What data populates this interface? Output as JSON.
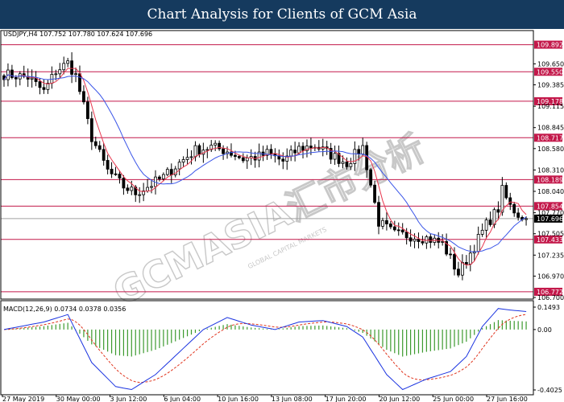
{
  "header": {
    "title": "Chart Analysis for Clients of GCM Asia"
  },
  "chart_data": {
    "type": "candlestick",
    "symbol_info": "USDJPY,H4  107.752 107.780 107.624 107.696",
    "price_axis": {
      "range": [
        106.7,
        110.05
      ],
      "ticks": [
        "109.650",
        "109.385",
        "109.115",
        "108.845",
        "108.580",
        "108.310",
        "108.040",
        "107.770",
        "107.505",
        "107.235",
        "106.970",
        "106.700"
      ]
    },
    "levels": [
      {
        "label": "109.892",
        "value": 109.892
      },
      {
        "label": "109.550",
        "value": 109.55
      },
      {
        "label": "109.178",
        "value": 109.178
      },
      {
        "label": "108.717",
        "value": 108.717
      },
      {
        "label": "108.189",
        "value": 108.189
      },
      {
        "label": "107.854",
        "value": 107.854
      },
      {
        "label": "107.433",
        "value": 107.433
      },
      {
        "label": "106.772",
        "value": 106.772
      }
    ],
    "current_price": {
      "label": "107.696",
      "value": 107.696
    },
    "x_axis_labels": [
      "27 May 2019",
      "30 May 00:00",
      "3 Jun 12:00",
      "6 Jun 04:00",
      "10 Jun 16:00",
      "13 Jun 08:00",
      "17 Jun 20:00",
      "20 Jun 12:00",
      "25 Jun 00:00",
      "27 Jun 16:00"
    ],
    "anchors": [
      [
        0,
        109.52
      ],
      [
        6,
        109.48
      ],
      [
        10,
        109.3
      ],
      [
        13,
        109.56
      ],
      [
        16,
        109.66
      ],
      [
        18,
        109.5
      ],
      [
        22,
        108.72
      ],
      [
        26,
        108.3
      ],
      [
        30,
        108.1
      ],
      [
        33,
        108.02
      ],
      [
        36,
        108.1
      ],
      [
        40,
        108.22
      ],
      [
        44,
        108.4
      ],
      [
        48,
        108.56
      ],
      [
        52,
        108.6
      ],
      [
        56,
        108.55
      ],
      [
        60,
        108.45
      ],
      [
        64,
        108.48
      ],
      [
        66,
        108.52
      ],
      [
        70,
        108.42
      ],
      [
        74,
        108.58
      ],
      [
        78,
        108.62
      ],
      [
        82,
        108.5
      ],
      [
        86,
        108.4
      ],
      [
        90,
        108.6
      ],
      [
        94,
        107.65
      ],
      [
        98,
        107.5
      ],
      [
        102,
        107.48
      ],
      [
        106,
        107.45
      ],
      [
        110,
        107.38
      ],
      [
        114,
        107.0
      ],
      [
        118,
        107.35
      ],
      [
        121,
        107.62
      ],
      [
        124,
        107.82
      ],
      [
        125,
        108.05
      ],
      [
        127,
        107.85
      ],
      [
        129,
        107.75
      ],
      [
        131,
        107.7
      ]
    ],
    "macd": {
      "label": "MACD(12,26,9) 0.0734 0.0378 0.0356",
      "range": [
        -0.4025,
        0.1493
      ],
      "ticks": [
        "0.1493",
        "0.00",
        "-0.4025"
      ],
      "anchors": [
        [
          0,
          0.0
        ],
        [
          10,
          0.05
        ],
        [
          16,
          0.1
        ],
        [
          22,
          -0.22
        ],
        [
          28,
          -0.38
        ],
        [
          32,
          -0.4
        ],
        [
          38,
          -0.3
        ],
        [
          44,
          -0.15
        ],
        [
          50,
          0.0
        ],
        [
          56,
          0.08
        ],
        [
          62,
          0.03
        ],
        [
          68,
          0.0
        ],
        [
          74,
          0.05
        ],
        [
          80,
          0.06
        ],
        [
          86,
          0.02
        ],
        [
          90,
          -0.05
        ],
        [
          96,
          -0.3
        ],
        [
          100,
          -0.4
        ],
        [
          106,
          -0.33
        ],
        [
          112,
          -0.28
        ],
        [
          116,
          -0.18
        ],
        [
          120,
          0.02
        ],
        [
          124,
          0.14
        ],
        [
          127,
          0.13
        ],
        [
          131,
          0.12
        ]
      ]
    }
  },
  "watermark": {
    "brand": "GCMASIA汇市分析",
    "tagline": "GLOBAL CAPITAL MARKETS"
  },
  "colors": {
    "banner": "#153a5e",
    "level": "#c3184a",
    "ma_red": "#e8384f",
    "ma_blue": "#3a55e8",
    "macd_hist": "#3c9a2e",
    "macd_signal": "#e0341d",
    "macd_line": "#1a33e0"
  }
}
